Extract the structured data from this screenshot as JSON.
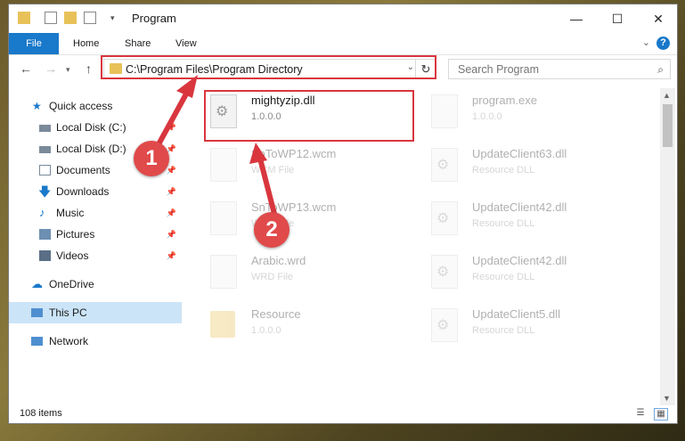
{
  "window": {
    "title": "Program",
    "tabs": {
      "file": "File",
      "home": "Home",
      "share": "Share",
      "view": "View"
    },
    "help_label": "?"
  },
  "address": {
    "path": "C:\\Program Files\\Program Directory",
    "search_placeholder": "Search Program"
  },
  "sidebar": {
    "items": [
      {
        "label": "Quick access"
      },
      {
        "label": "Local Disk (C:)"
      },
      {
        "label": "Local Disk (D:)"
      },
      {
        "label": "Documents"
      },
      {
        "label": "Downloads"
      },
      {
        "label": "Music"
      },
      {
        "label": "Pictures"
      },
      {
        "label": "Videos"
      },
      {
        "label": "OneDrive"
      },
      {
        "label": "This PC"
      },
      {
        "label": "Network"
      }
    ]
  },
  "files": [
    {
      "name": "mightyzip.dll",
      "sub": "1.0.0.0"
    },
    {
      "name": "program.exe",
      "sub": "1.0.0.0"
    },
    {
      "name": "SnToWP12.wcm",
      "sub": "WCM File"
    },
    {
      "name": "UpdateClient63.dll",
      "sub": "Resource DLL"
    },
    {
      "name": "SnToWP13.wcm",
      "sub": "WCM File"
    },
    {
      "name": "UpdateClient42.dll",
      "sub": "Resource DLL"
    },
    {
      "name": "Arabic.wrd",
      "sub": "WRD File"
    },
    {
      "name": "UpdateClient42.dll",
      "sub": "Resource DLL"
    },
    {
      "name": "Resource",
      "sub": "1.0.0.0"
    },
    {
      "name": "UpdateClient5.dll",
      "sub": "Resource DLL"
    }
  ],
  "status": {
    "count": "108 items"
  },
  "callouts": {
    "one": "1",
    "two": "2"
  },
  "colors": {
    "accent": "#1979ca",
    "annotation": "#d9363e",
    "selected": "#cce4f7"
  }
}
